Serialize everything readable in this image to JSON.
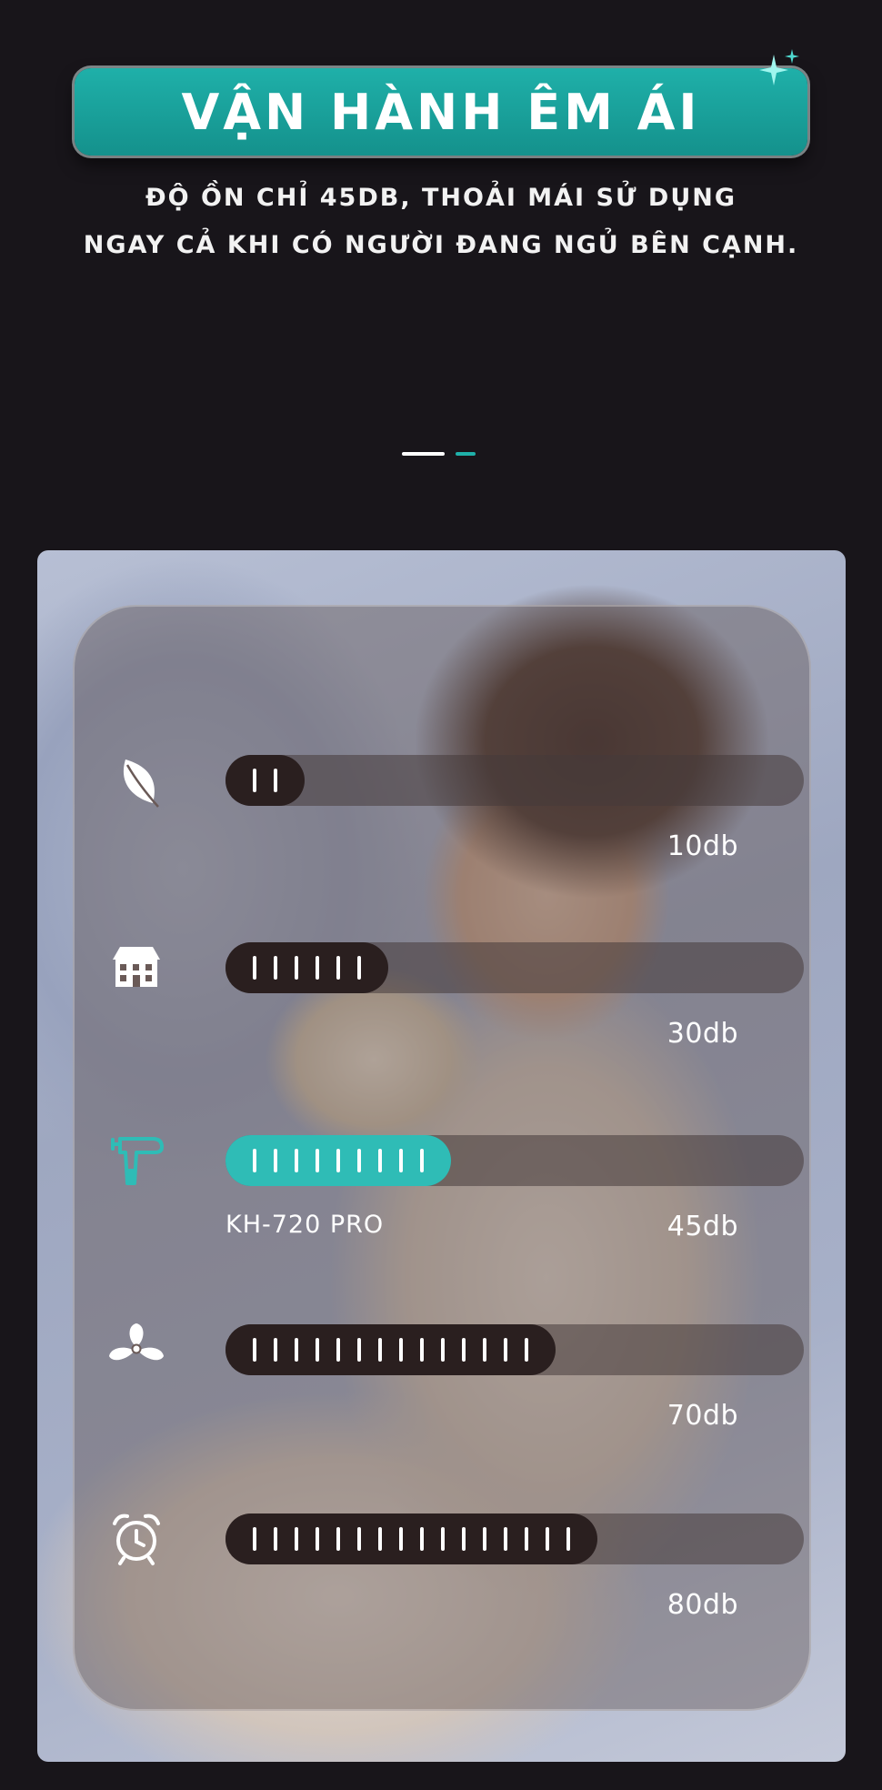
{
  "header": {
    "title": "VẬN HÀNH ÊM ÁI",
    "subtitle_line1": "ĐỘ ỒN CHỈ 45DB, THOẢI MÁI SỬ DỤNG",
    "subtitle_line2": "NGAY CẢ KHI CÓ NGƯỜI ĐANG NGỦ BÊN CẠNH.",
    "accent_color": "#1fb0a9"
  },
  "pager": {
    "total": 2,
    "active_index": 0
  },
  "noise_levels": [
    {
      "icon": "leaf-icon",
      "db_label": "10db",
      "level": 10,
      "ticks": 2,
      "highlight": false,
      "model": ""
    },
    {
      "icon": "house-icon",
      "db_label": "30db",
      "level": 30,
      "ticks": 6,
      "highlight": false,
      "model": ""
    },
    {
      "icon": "massage-gun-icon",
      "db_label": "45db",
      "level": 45,
      "ticks": 9,
      "highlight": true,
      "model": "KH-720 PRO"
    },
    {
      "icon": "fan-icon",
      "db_label": "70db",
      "level": 70,
      "ticks": 14,
      "highlight": false,
      "model": ""
    },
    {
      "icon": "alarm-clock-icon",
      "db_label": "80db",
      "level": 80,
      "ticks": 16,
      "highlight": false,
      "model": ""
    }
  ]
}
